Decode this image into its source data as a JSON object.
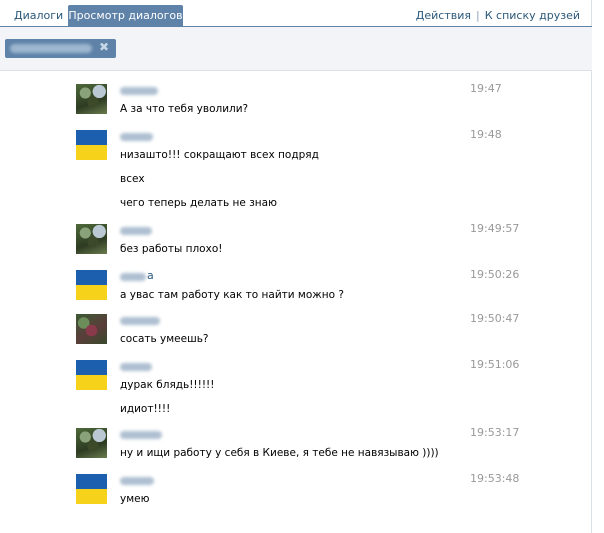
{
  "tabs": {
    "dialogs": "Диалоги",
    "view_dialogs": "Просмотр диалогов"
  },
  "actions": {
    "actions_link": "Действия",
    "separator": "|",
    "friends_link": "К списку друзей"
  },
  "search": {
    "remove_symbol": "✖"
  },
  "messages": [
    {
      "avatar": "photo",
      "name_suffix": "",
      "time": "19:47",
      "lines": [
        "А за что тебя уволили?"
      ]
    },
    {
      "avatar": "flag",
      "name_suffix": "",
      "time": "19:48",
      "lines": [
        "низашто!!! сокращают всех подряд",
        "всех",
        "чего теперь делать не знаю"
      ]
    },
    {
      "avatar": "photo",
      "name_suffix": "",
      "time": "19:49:57",
      "lines": [
        "без работы плохо!"
      ]
    },
    {
      "avatar": "flag",
      "name_suffix": "а",
      "time": "19:50:26",
      "lines": [
        "а увас там работу как то найти можно ?"
      ]
    },
    {
      "avatar": "photo2",
      "name_suffix": "",
      "time": "19:50:47",
      "lines": [
        "сосать умеешь?"
      ]
    },
    {
      "avatar": "flag",
      "name_suffix": "",
      "time": "19:51:06",
      "lines": [
        "дурак блядь!!!!!!",
        "идиот!!!!"
      ]
    },
    {
      "avatar": "photo",
      "name_suffix": "",
      "time": "19:53:17",
      "lines": [
        "ну и ищи работу у себя в Киеве, я тебе не навязываю ))))"
      ]
    },
    {
      "avatar": "flag",
      "name_suffix": "",
      "time": "19:53:48",
      "lines": [
        "умею"
      ]
    }
  ]
}
